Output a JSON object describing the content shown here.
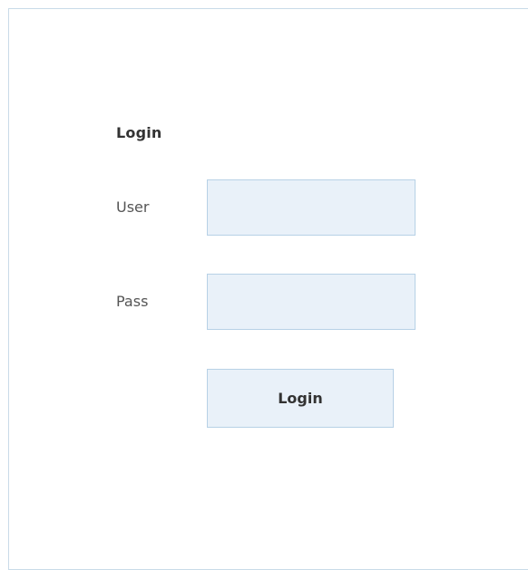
{
  "login_form": {
    "title": "Login",
    "user_label": "User",
    "user_value": "",
    "user_placeholder": "",
    "pass_label": "Pass",
    "pass_value": "",
    "pass_placeholder": "",
    "submit_label": "Login"
  },
  "colors": {
    "frame_border": "#c9dbe8",
    "input_background": "#e9f1f9",
    "input_border": "#b7d1e6",
    "text": "#333333"
  }
}
